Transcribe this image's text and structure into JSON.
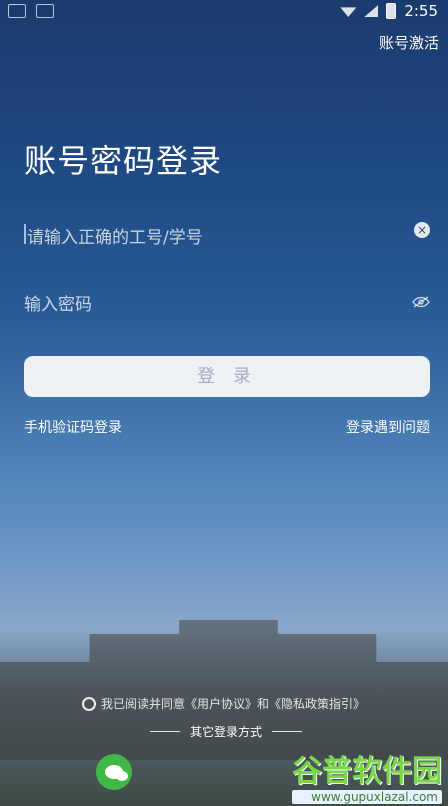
{
  "status_bar": {
    "time": "2:55"
  },
  "header": {
    "activate_label": "账号激活",
    "title": "账号密码登录"
  },
  "form": {
    "username_placeholder": "请输入正确的工号/学号",
    "password_placeholder": "输入密码",
    "login_button": "登 录"
  },
  "links": {
    "phone_login": "手机验证码登录",
    "help": "登录遇到问题"
  },
  "agreement": {
    "text": "我已阅读并同意《用户协议》和《隐私政策指引》"
  },
  "other": {
    "label": "其它登录方式"
  },
  "watermark": {
    "brand": "谷普软件园",
    "url": "www.gupuxlazal.com"
  },
  "icons": {
    "clear": "clear-icon",
    "eye_off": "eye-off-icon",
    "wechat": "wechat-icon"
  }
}
